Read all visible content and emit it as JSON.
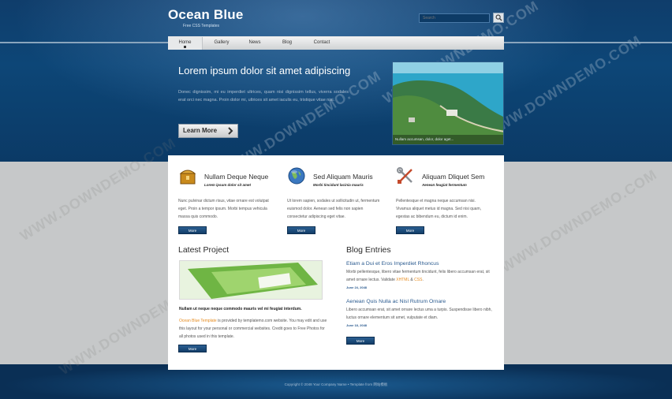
{
  "header": {
    "site_title": "Ocean Blue",
    "tagline": "Free CSS Templates",
    "search_placeholder": "Search",
    "search_icon": "magnifier-icon"
  },
  "nav": {
    "items": [
      {
        "label": "Home",
        "active": true
      },
      {
        "label": "Gallery"
      },
      {
        "label": "News"
      },
      {
        "label": "Blog"
      },
      {
        "label": "Contact"
      }
    ]
  },
  "hero": {
    "title": "Lorem ipsum dolor sit amet adipiscing",
    "text": "Donec dignissim, mi eu imperdiet ultrices, quam nisi dignissim tellus, viverra sodales erat orci nec magna. Proin dolor mi, ultrices sit amet iaculis eu, tristique vitae nisi.",
    "button_label": "Learn More",
    "image_caption": "Nullam accumsan, dolor, dolor aget..."
  },
  "features": [
    {
      "icon": "treasure-chest-icon",
      "title": "Nullam Deque Neque",
      "subtitle": "Lorem ipsum dolor sit amet",
      "text": "Nunc pulvinar dictum risus, vitae ornare est volutpat eget. Proin a tempor ipsum. Morbi tempus vehicula massa quis commodo.",
      "more": "More"
    },
    {
      "icon": "globe-icon",
      "title": "Sed Aliquam Mauris",
      "subtitle": "Morbi tincidunt lacinia mauris",
      "text": "Ut lorem sapien, sodales ut sollicitudin ut, fermentum euismod dolor. Aenean sed felis non sapien consectetur adipiscing eget vitae.",
      "more": "More"
    },
    {
      "icon": "tools-icon",
      "title": "Aliquam Dliquet Sem",
      "subtitle": "Aenean feugiat fermentum",
      "text": "Pellentesque et magna neque accumsan nisi. Vivamus aliquet metus id magna. Sed nisi quam, egestas ac bibendum eu, dictum id enim.",
      "more": "More"
    }
  ],
  "latest_project": {
    "heading": "Latest Project",
    "strong_line": "Nullam ut neque neque commodo mauris vel mi feugiat interdum.",
    "highlight": "Ocean Blue Template",
    "text": " is provided by templatemo.com website. You may edit and use this layout for your personal or commercial websites. Credit goes to Free Photos for all photos used in this template.",
    "more": "More"
  },
  "blog": {
    "heading": "Blog Entries",
    "entries": [
      {
        "title": "Etiam a Dui et Eros Imperdiet Rhoncus",
        "text_before": "Morbi pellentesque, libero vitae fermentum tincidunt, felis libero accumsan erat, sit amet ornare lectus. Validate ",
        "hl1": "XHTML",
        "mid": " & ",
        "hl2": "CSS",
        "text_after": ".",
        "date": "June 24, 2048"
      },
      {
        "title": "Aenean Quis Nulla ac Nisl Rutrum Ornare",
        "text": "Libero accumsan erat, sit amet ornare lectus uma a turpis. Suspendisse libero nibh, luctus ornare elementum sit amet, vulputate et diam.",
        "date": "June 18, 2048"
      }
    ],
    "more": "More"
  },
  "footer": {
    "text": "Copyright © 2048 Your Company Name • Template from 网站模板"
  },
  "watermark": "WWW.DOWNDEMO.COM",
  "colors": {
    "accent_blue": "#0d4677",
    "link_blue": "#2a5a8f",
    "highlight_orange": "#e58a1d"
  }
}
